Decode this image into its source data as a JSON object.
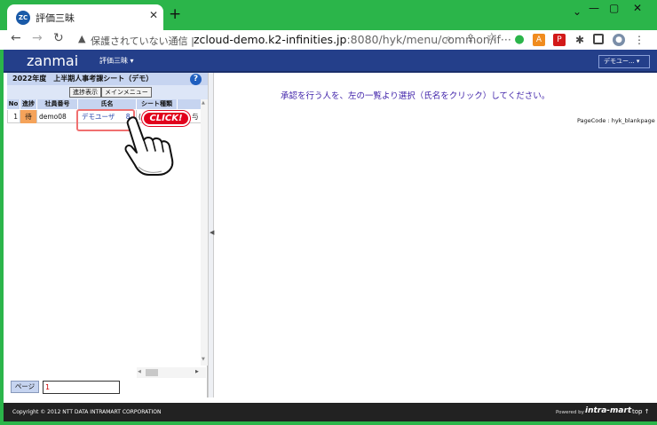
{
  "browser": {
    "tab_icon": "ZC",
    "tab_title": "評価三昧",
    "close_glyph": "✕",
    "newtab_glyph": "+",
    "window_controls": [
      "⌄",
      "—",
      "▢",
      "✕"
    ],
    "security_text": "保護されていない通信",
    "url_host": "zcloud-demo.k2-infinities.jp",
    "url_rest": ":8080/hyk/menu/common/if···",
    "extension_icons": [
      "evernote-icon",
      "aws-icon",
      "pdf-icon",
      "puzzle-icon",
      "sidepanel-icon",
      "profile-icon",
      "kebab-icon"
    ]
  },
  "app": {
    "logo": "zanmai",
    "menu_eval": "評価三昧 ▾",
    "user_menu": "デモユー... ▾"
  },
  "left": {
    "title": "2022年度　上半期人事考課シート（デモ）",
    "help": "?",
    "buttons": {
      "progress": "進捗表示",
      "main_menu": "メインメニュー"
    },
    "headers": [
      "No",
      "進捗",
      "社員番号",
      "氏名",
      "シート種類"
    ],
    "rows": [
      {
        "no": "1",
        "status": "待",
        "emp_id": "demo08",
        "name": "デモユーザ",
        "suffix": "8",
        "sheet": "(",
        "extra": "与"
      }
    ],
    "page_label": "ページ",
    "page_value": "1"
  },
  "main": {
    "instruction": "承認を行う人を、左の一覧より選択（氏名をクリック）してください。",
    "pagecode": "PageCode : hyk_blankpage"
  },
  "footer": {
    "copyright": "Copyright © 2012 NTT DATA INTRAMART CORPORATION",
    "powered": "Powered by",
    "brand": "intra-mart",
    "top_link": "top ↑"
  },
  "annotation": {
    "click_label": "CLICK!"
  },
  "colors": {
    "chrome_green": "#2bb54a",
    "header_blue": "#243f8a",
    "status_orange": "#f5a35a",
    "click_red": "#e1001c"
  }
}
